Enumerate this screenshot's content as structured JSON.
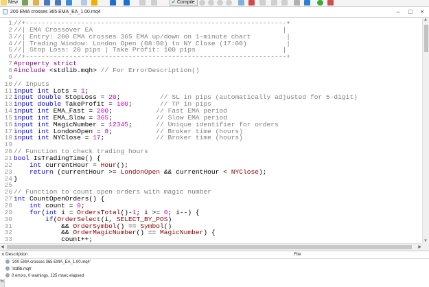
{
  "toolbar": {
    "new_label": "New",
    "compile_label": "Compile"
  },
  "document": {
    "title": "200 EMA crosses 365 EMA_EA_1.00.mq4"
  },
  "editor": {
    "lines": [
      {
        "n": "1",
        "tokens": [
          {
            "t": "comment",
            "v": "//+------------------------------------------------------------------+"
          }
        ]
      },
      {
        "n": "2",
        "tokens": [
          {
            "t": "comment",
            "v": "//| EMA Crossover EA                                                |"
          }
        ]
      },
      {
        "n": "3",
        "tokens": [
          {
            "t": "comment",
            "v": "//| Entry: 200 EMA crosses 365 EMA up/down on 1-minute chart         |"
          }
        ]
      },
      {
        "n": "4",
        "tokens": [
          {
            "t": "comment",
            "v": "//| Trading Window: London Open (08:00) to NY Close (17:00)          |"
          }
        ]
      },
      {
        "n": "5",
        "tokens": [
          {
            "t": "comment",
            "v": "//| Stop Loss: 20 pips | Take Profit: 100 pips                      |"
          }
        ]
      },
      {
        "n": "6",
        "tokens": [
          {
            "t": "comment",
            "v": "//+------------------------------------------------------------------+"
          }
        ]
      },
      {
        "n": "7",
        "tokens": [
          {
            "t": "pp",
            "v": "#property strict"
          }
        ]
      },
      {
        "n": "8",
        "tokens": [
          {
            "t": "pp",
            "v": "#include "
          },
          {
            "t": "id",
            "v": "<stdlib.mqh> "
          },
          {
            "t": "comment",
            "v": "// For ErrorDescription()"
          }
        ]
      },
      {
        "n": "9",
        "tokens": []
      },
      {
        "n": "10",
        "tokens": [
          {
            "t": "comment",
            "v": "// Inputs"
          }
        ]
      },
      {
        "n": "11",
        "tokens": [
          {
            "t": "kw",
            "v": "input int "
          },
          {
            "t": "id",
            "v": "Lots = "
          },
          {
            "t": "num",
            "v": "1"
          },
          {
            "t": "id",
            "v": ";"
          }
        ]
      },
      {
        "n": "12",
        "tokens": [
          {
            "t": "kw",
            "v": "input double "
          },
          {
            "t": "id",
            "v": "StopLoss = "
          },
          {
            "t": "num",
            "v": "20"
          },
          {
            "t": "id",
            "v": ";          "
          },
          {
            "t": "comment",
            "v": "// SL in pips (automatically adjusted for 5-digit)"
          }
        ]
      },
      {
        "n": "13",
        "tokens": [
          {
            "t": "kw",
            "v": "input double "
          },
          {
            "t": "id",
            "v": "TakeProfit = "
          },
          {
            "t": "num",
            "v": "100"
          },
          {
            "t": "id",
            "v": ";       "
          },
          {
            "t": "comment",
            "v": "// TP in pips"
          }
        ]
      },
      {
        "n": "14",
        "tokens": [
          {
            "t": "kw",
            "v": "input int "
          },
          {
            "t": "id",
            "v": "EMA_Fast = "
          },
          {
            "t": "num",
            "v": "200"
          },
          {
            "t": "id",
            "v": ";           "
          },
          {
            "t": "comment",
            "v": "// Fast EMA period"
          }
        ]
      },
      {
        "n": "15",
        "tokens": [
          {
            "t": "kw",
            "v": "input int "
          },
          {
            "t": "id",
            "v": "EMA_Slow = "
          },
          {
            "t": "num",
            "v": "365"
          },
          {
            "t": "id",
            "v": ";           "
          },
          {
            "t": "comment",
            "v": "// Slow EMA period"
          }
        ]
      },
      {
        "n": "16",
        "tokens": [
          {
            "t": "kw",
            "v": "input int "
          },
          {
            "t": "id",
            "v": "MagicNumber = "
          },
          {
            "t": "num",
            "v": "12345"
          },
          {
            "t": "id",
            "v": ";      "
          },
          {
            "t": "comment",
            "v": "// Unique identifier for orders"
          }
        ]
      },
      {
        "n": "17",
        "tokens": [
          {
            "t": "kw",
            "v": "input int "
          },
          {
            "t": "id",
            "v": "LondonOpen = "
          },
          {
            "t": "num",
            "v": "8"
          },
          {
            "t": "id",
            "v": ";           "
          },
          {
            "t": "comment",
            "v": "// Broker time (hours)"
          }
        ]
      },
      {
        "n": "18",
        "tokens": [
          {
            "t": "kw",
            "v": "input int "
          },
          {
            "t": "id",
            "v": "NYClose = "
          },
          {
            "t": "num",
            "v": "17"
          },
          {
            "t": "id",
            "v": ";             "
          },
          {
            "t": "comment",
            "v": "// Broker time (hours)"
          }
        ]
      },
      {
        "n": "19",
        "tokens": []
      },
      {
        "n": "20",
        "tokens": [
          {
            "t": "comment",
            "v": "// Function to check trading hours"
          }
        ]
      },
      {
        "n": "21",
        "tokens": [
          {
            "t": "type",
            "v": "bool "
          },
          {
            "t": "id",
            "v": "IsTradingTime() {"
          }
        ]
      },
      {
        "n": "22",
        "tokens": [
          {
            "t": "type",
            "v": "    int "
          },
          {
            "t": "id",
            "v": "currentHour = "
          },
          {
            "t": "fn",
            "v": "Hour"
          },
          {
            "t": "id",
            "v": "();"
          }
        ]
      },
      {
        "n": "23",
        "tokens": [
          {
            "t": "kw",
            "v": "    return "
          },
          {
            "t": "id",
            "v": "(currentHour >= "
          },
          {
            "t": "const",
            "v": "LondonOpen"
          },
          {
            "t": "id",
            "v": " && currentHour < "
          },
          {
            "t": "const",
            "v": "NYClose"
          },
          {
            "t": "id",
            "v": ");"
          }
        ]
      },
      {
        "n": "24",
        "tokens": [
          {
            "t": "id",
            "v": "}"
          }
        ]
      },
      {
        "n": "25",
        "tokens": []
      },
      {
        "n": "26",
        "tokens": [
          {
            "t": "comment",
            "v": "// Function to count open orders with magic number"
          }
        ]
      },
      {
        "n": "27",
        "tokens": [
          {
            "t": "type",
            "v": "int "
          },
          {
            "t": "id",
            "v": "CountOpenOrders() {"
          }
        ]
      },
      {
        "n": "28",
        "tokens": [
          {
            "t": "type",
            "v": "    int "
          },
          {
            "t": "id",
            "v": "count = "
          },
          {
            "t": "num",
            "v": "0"
          },
          {
            "t": "id",
            "v": ";"
          }
        ]
      },
      {
        "n": "29",
        "tokens": [
          {
            "t": "kw",
            "v": "    for"
          },
          {
            "t": "id",
            "v": "("
          },
          {
            "t": "type",
            "v": "int "
          },
          {
            "t": "id",
            "v": "i = "
          },
          {
            "t": "fn",
            "v": "OrdersTotal"
          },
          {
            "t": "id",
            "v": "()-"
          },
          {
            "t": "num",
            "v": "1"
          },
          {
            "t": "id",
            "v": "; i >= "
          },
          {
            "t": "num",
            "v": "0"
          },
          {
            "t": "id",
            "v": "; i--) {"
          }
        ]
      },
      {
        "n": "30",
        "tokens": [
          {
            "t": "kw",
            "v": "        if"
          },
          {
            "t": "id",
            "v": "("
          },
          {
            "t": "fn",
            "v": "OrderSelect"
          },
          {
            "t": "id",
            "v": "(i, "
          },
          {
            "t": "const",
            "v": "SELECT_BY_POS"
          },
          {
            "t": "id",
            "v": ")"
          }
        ]
      },
      {
        "n": "31",
        "tokens": [
          {
            "t": "id",
            "v": "            && "
          },
          {
            "t": "fn",
            "v": "OrderSymbol"
          },
          {
            "t": "id",
            "v": "() == "
          },
          {
            "t": "fn",
            "v": "Symbol"
          },
          {
            "t": "id",
            "v": "()"
          }
        ]
      },
      {
        "n": "32",
        "tokens": [
          {
            "t": "id",
            "v": "            && "
          },
          {
            "t": "fn",
            "v": "OrderMagicNumber"
          },
          {
            "t": "id",
            "v": "() == "
          },
          {
            "t": "const",
            "v": "MagicNumber"
          },
          {
            "t": "id",
            "v": ") {"
          }
        ]
      },
      {
        "n": "33",
        "tokens": [
          {
            "t": "id",
            "v": "            count++;"
          }
        ]
      }
    ]
  },
  "toolbox": {
    "col_description": "Description",
    "col_file": "File",
    "messages": [
      "'200 EMA crosses 365 EMA_EA_1.00.mq4'",
      "'stdlib.mqh'",
      "0 errors, 0 warnings, 125 msec elapsed"
    ]
  }
}
